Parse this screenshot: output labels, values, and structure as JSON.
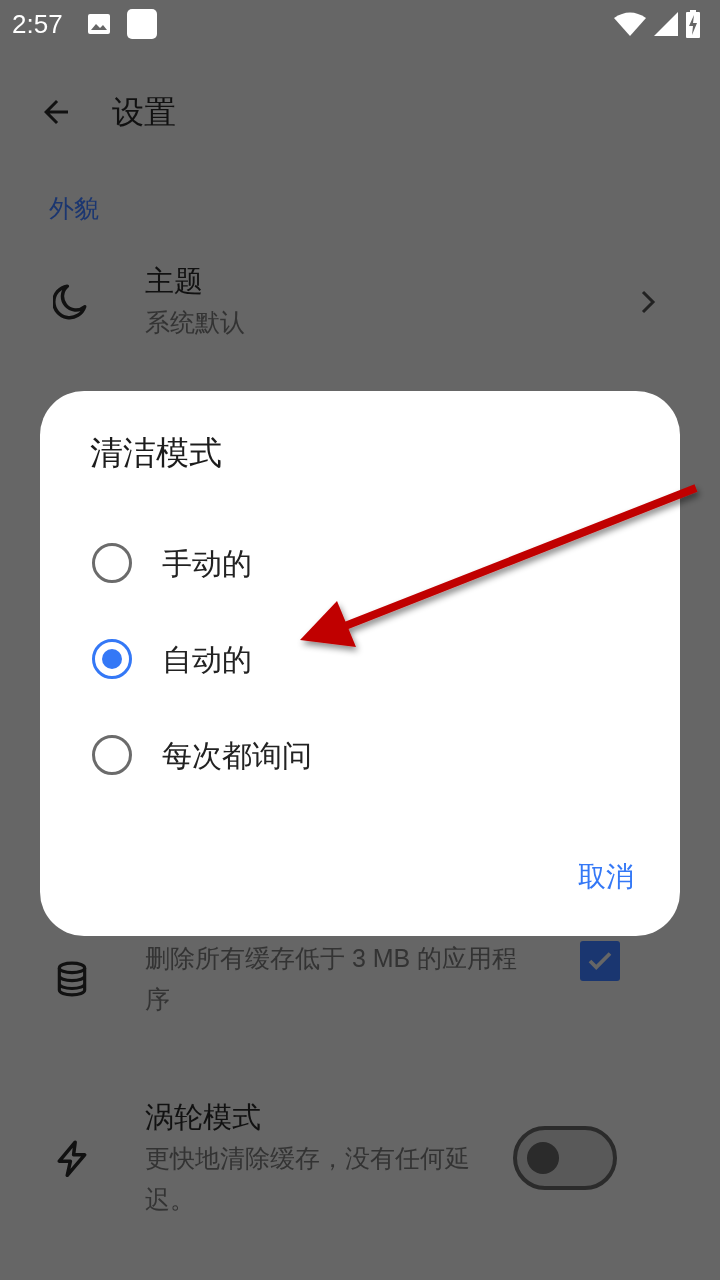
{
  "status_bar": {
    "time": "2:57"
  },
  "app_bar": {
    "title": "设置"
  },
  "section": {
    "title": "外貌"
  },
  "settings": [
    {
      "kind": "link",
      "title": "主题",
      "subtitle": "系统默认"
    },
    {
      "kind": "checkbox",
      "subtitle": "删除所有缓存低于 3 MB 的应用程序",
      "checked": true
    },
    {
      "kind": "switch",
      "title": "涡轮模式",
      "subtitle": "更快地清除缓存，没有任何延迟。",
      "on": false
    }
  ],
  "dialog": {
    "title": "清洁模式",
    "options": [
      {
        "label": "手动的",
        "selected": false
      },
      {
        "label": "自动的",
        "selected": true
      },
      {
        "label": "每次都询问",
        "selected": false
      }
    ],
    "button": "取消"
  }
}
